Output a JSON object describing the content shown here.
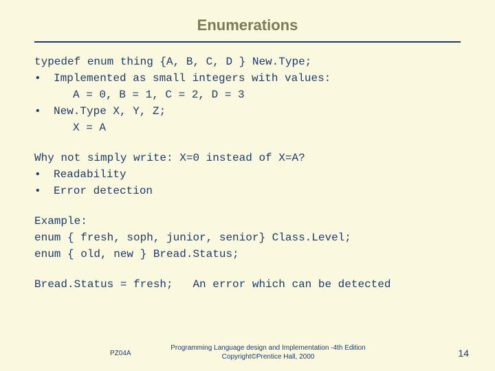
{
  "title": "Enumerations",
  "sec1": {
    "typedef": "typedef enum thing {A, B, C, D } New.Type;",
    "b1": "Implemented as small integers with values:",
    "b1sub": "A = 0, B = 1, C = 2, D = 3",
    "b2": "New.Type X, Y, Z;",
    "b2sub": "X = A"
  },
  "sec2": {
    "q": "Why not simply write: X=0 instead of X=A?",
    "b1": "Readability",
    "b2": "Error detection"
  },
  "sec3": {
    "ex": "Example:",
    "l1": "enum { fresh, soph, junior, senior} Class.Level;",
    "l2": "enum { old, new } Bread.Status;"
  },
  "sec4": {
    "line": "Bread.Status = fresh;   An error which can be detected"
  },
  "bullet": "•",
  "footer": {
    "left": "PZ04A",
    "center1": "Programming Language design and Implementation -4th Edition",
    "center2": "Copyright©Prentice Hall, 2000"
  },
  "page": "14"
}
